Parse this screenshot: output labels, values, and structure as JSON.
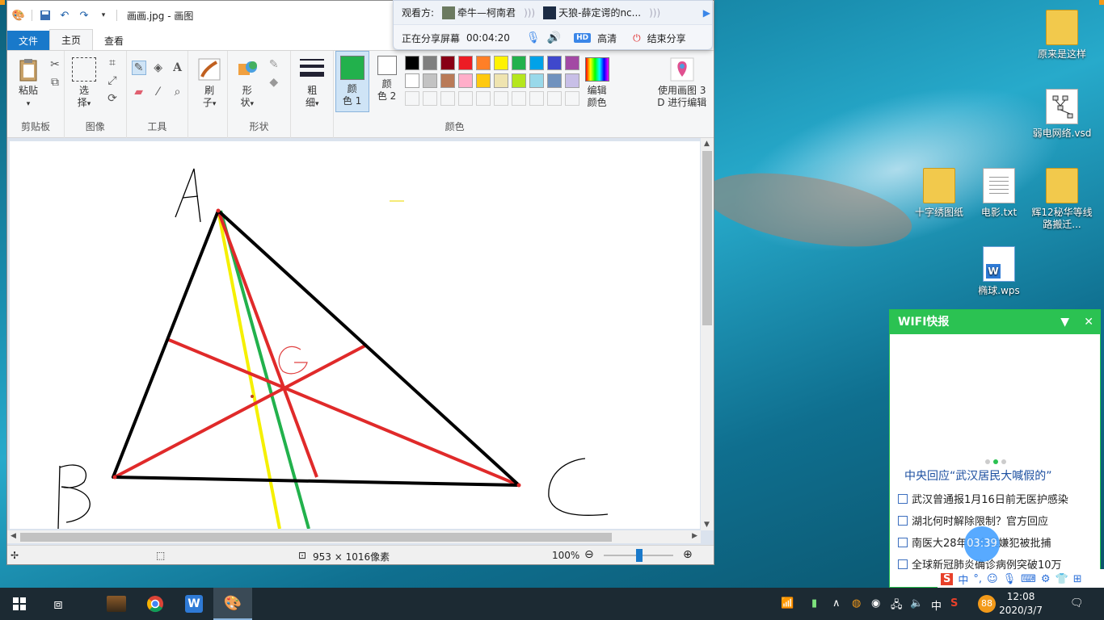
{
  "paint": {
    "title": "画画.jpg - 画图",
    "tabs": [
      "文件",
      "主页",
      "查看"
    ],
    "groups": {
      "clipboard": "剪贴板",
      "image": "图像",
      "tools": "工具",
      "shapes": "形状",
      "colors": "颜色"
    },
    "buttons": {
      "paste": "粘贴",
      "select_a": "选",
      "select_b": "择",
      "brush_a": "刷",
      "brush_b": "子",
      "shapes_a": "形",
      "shapes_b": "状",
      "size_a": "粗",
      "size_b": "细",
      "color1_a": "颜",
      "color1_b": "色 1",
      "color2_a": "颜",
      "color2_b": "色 2",
      "edit_colors_a": "编辑",
      "edit_colors_b": "颜色",
      "paint3d_a": "使用画图 3",
      "paint3d_b": "D 进行编辑"
    },
    "palette_row1": [
      "#000000",
      "#7f7f7f",
      "#880015",
      "#ed1c24",
      "#ff7f27",
      "#fff200",
      "#22b14c",
      "#00a2e8",
      "#3f48cc",
      "#a349a4"
    ],
    "palette_row2": [
      "#ffffff",
      "#c3c3c3",
      "#b97a57",
      "#ffaec9",
      "#ffc90e",
      "#efe4b0",
      "#b5e61d",
      "#99d9ea",
      "#7092be",
      "#c8bfe7"
    ],
    "color1": "#22b14c",
    "color2": "#ffffff",
    "status": {
      "size": "953 × 1016像素",
      "zoom": "100%"
    },
    "labels": {
      "a": "A",
      "b": "B",
      "c": "C",
      "g": "G"
    }
  },
  "share": {
    "viewer_label": "观看方:",
    "viewer1": "牵牛—柯南君",
    "viewer2": "天狼-薛定谔的nc...",
    "sharing_label": "正在分享屏幕",
    "elapsed": "00:04:20",
    "hd_badge": "HD",
    "quality": "高清",
    "end": "结束分享"
  },
  "desktop": {
    "icons": [
      "原来是这样",
      "弱电网络.vsd",
      "十字绣图纸",
      "电影.txt",
      "辉12秘华等线路搬迁...",
      "椭球.wps"
    ]
  },
  "wifi": {
    "title": "WIFI快报",
    "headline": "中央回应“武汉居民大喊假的”",
    "news": [
      "武汉曾通报1月16日前无医护感染",
      "湖北何时解除限制？官方回应",
      "南医大28年前命案嫌犯被批捕",
      "全球新冠肺炎确诊病例突破10万"
    ],
    "timer": "03:39"
  },
  "taskbar": {
    "time": "12:08",
    "date": "2020/3/7",
    "ime": "中",
    "badge": "88"
  }
}
